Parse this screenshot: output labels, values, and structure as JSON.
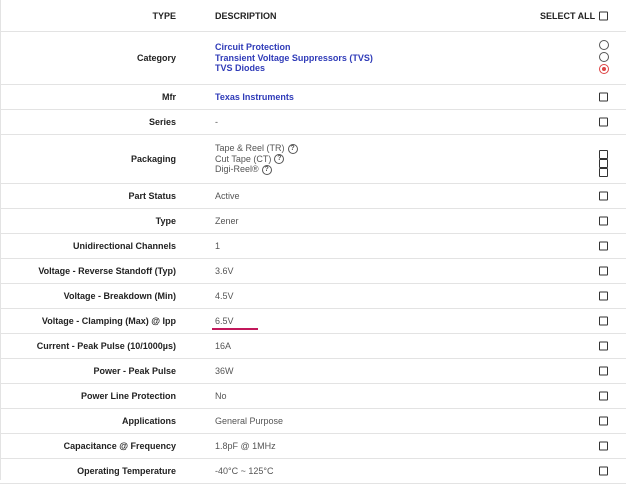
{
  "header": {
    "type": "TYPE",
    "description": "DESCRIPTION",
    "select_all": "SELECT ALL"
  },
  "category": {
    "label": "Category",
    "values": [
      "Circuit Protection",
      "Transient Voltage Suppressors (TVS)",
      "TVS Diodes"
    ],
    "selected_index": 2
  },
  "mfr": {
    "label": "Mfr",
    "value": "Texas Instruments"
  },
  "series": {
    "label": "Series",
    "value": "-"
  },
  "packaging": {
    "label": "Packaging",
    "options": [
      "Tape & Reel (TR)",
      "Cut Tape (CT)",
      "Digi-Reel®"
    ],
    "help_icon": "question-circle-icon"
  },
  "rows": [
    {
      "label": "Part Status",
      "value": "Active"
    },
    {
      "label": "Type",
      "value": "Zener"
    },
    {
      "label": "Unidirectional Channels",
      "value": "1"
    },
    {
      "label": "Voltage - Reverse Standoff (Typ)",
      "value": "3.6V"
    },
    {
      "label": "Voltage - Breakdown (Min)",
      "value": "4.5V"
    },
    {
      "label": "Voltage - Clamping (Max) @ Ipp",
      "value": "6.5V"
    },
    {
      "label": "Current - Peak Pulse (10/1000µs)",
      "value": "16A"
    },
    {
      "label": "Power - Peak Pulse",
      "value": "36W"
    },
    {
      "label": "Power Line Protection",
      "value": "No"
    },
    {
      "label": "Applications",
      "value": "General Purpose"
    },
    {
      "label": "Capacitance @ Frequency",
      "value": "1.8pF @ 1MHz"
    },
    {
      "label": "Operating Temperature",
      "value": "-40°C ~ 125°C"
    }
  ],
  "colors": {
    "link": "#2f3bb8",
    "underline": "#c2185b",
    "radio_selected": "#dd4444"
  }
}
